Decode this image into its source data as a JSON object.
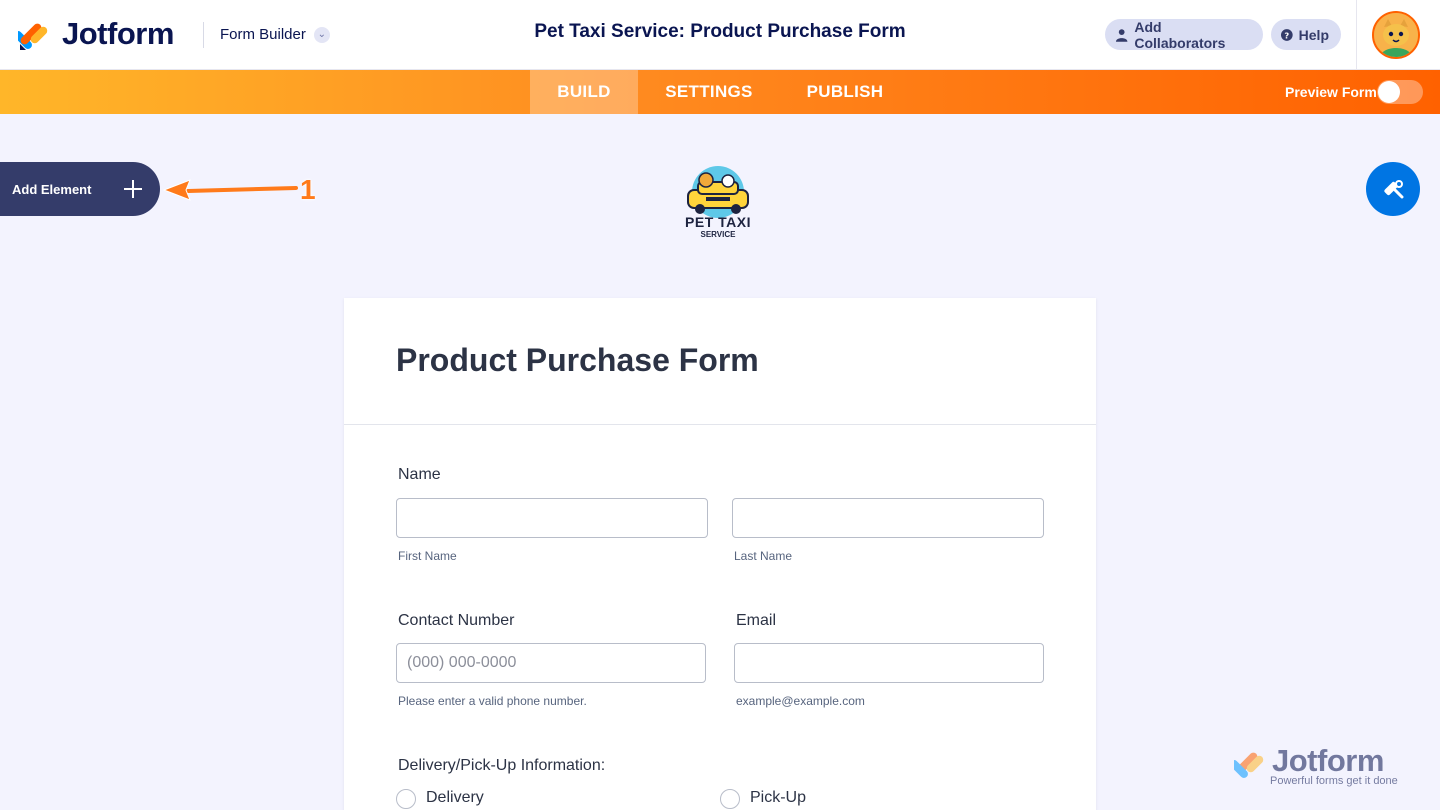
{
  "header": {
    "brand": "Jotform",
    "builder_label": "Form Builder",
    "form_title": "Pet Taxi Service: Product Purchase Form",
    "collaborators_label": "Add Collaborators",
    "help_label": "Help"
  },
  "nav": {
    "tabs": [
      {
        "label": "BUILD",
        "active": true
      },
      {
        "label": "SETTINGS",
        "active": false
      },
      {
        "label": "PUBLISH",
        "active": false
      }
    ],
    "preview_label": "Preview Form",
    "preview_on": false
  },
  "sidebar": {
    "add_element_label": "Add Element",
    "annotation_number": "1"
  },
  "form": {
    "logo_text": "PET TAXI",
    "logo_subtext": "SERVICE",
    "title": "Product Purchase Form",
    "name_label": "Name",
    "first_name_sub": "First Name",
    "last_name_sub": "Last Name",
    "contact_label": "Contact Number",
    "contact_placeholder": "(000) 000-0000",
    "contact_sub": "Please enter a valid phone number.",
    "email_label": "Email",
    "email_sub": "example@example.com",
    "delivery_label": "Delivery/Pick-Up Information:",
    "options": [
      "Delivery",
      "Pick-Up"
    ]
  },
  "watermark": {
    "brand": "Jotform",
    "tagline": "Powerful forms get it done"
  },
  "colors": {
    "navy": "#0a1551",
    "orange": "#ff6100",
    "blue": "#0075e3"
  }
}
